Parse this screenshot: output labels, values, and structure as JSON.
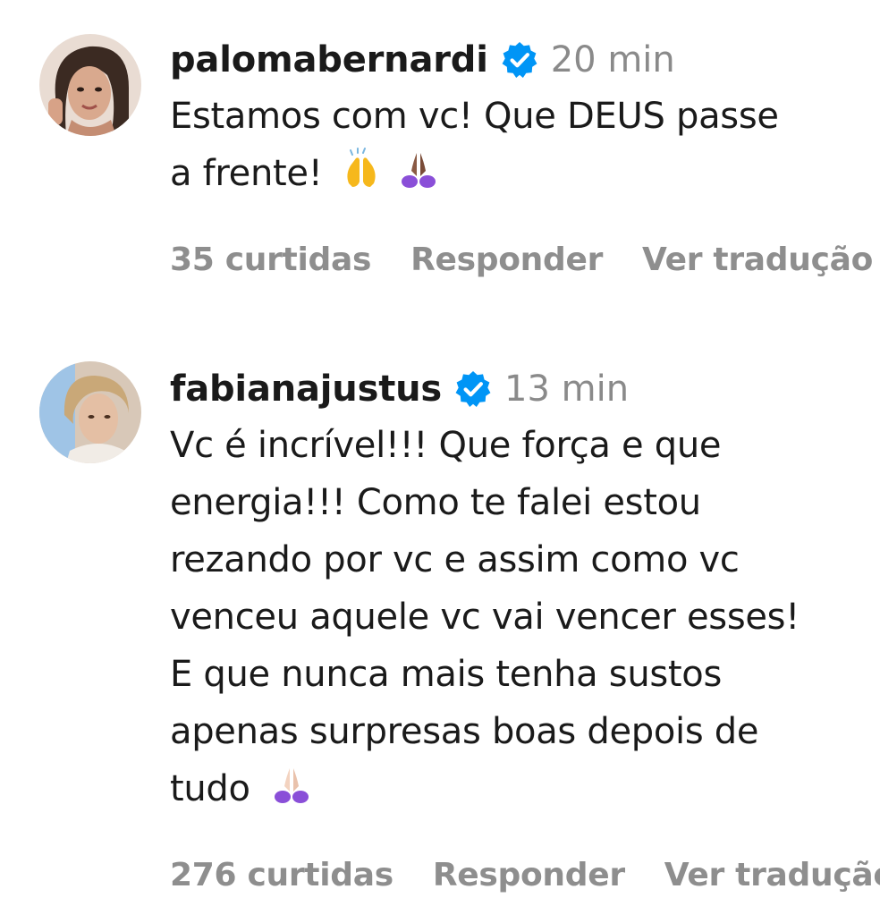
{
  "comments": [
    {
      "username": "palomabernardi",
      "time": "20 min",
      "lines": [
        "Estamos com vc! Que DEUS passe",
        "a frente!"
      ],
      "likes": "35 curtidas",
      "reply": "Responder",
      "translate": "Ver tradução",
      "emojis": [
        "pray-hands-yellow-icon",
        "pray-hands-brown-icon"
      ]
    },
    {
      "username": "fabianajustus",
      "time": "13 min",
      "lines": [
        "Vc é incrível!!! Que força e que",
        "energia!!! Como te falei estou",
        "rezando por vc e assim como vc",
        "venceu aquele vc vai vencer esses!",
        "E que nunca mais tenha sustos",
        "apenas surpresas boas depois de",
        "tudo"
      ],
      "likes": "276 curtidas",
      "reply": "Responder",
      "translate": "Ver tradução",
      "emojis": [
        "pray-hands-light-icon"
      ]
    }
  ],
  "colors": {
    "verified": "#0095f6",
    "muted": "#8e8e8e",
    "text": "#1a1a1a"
  }
}
